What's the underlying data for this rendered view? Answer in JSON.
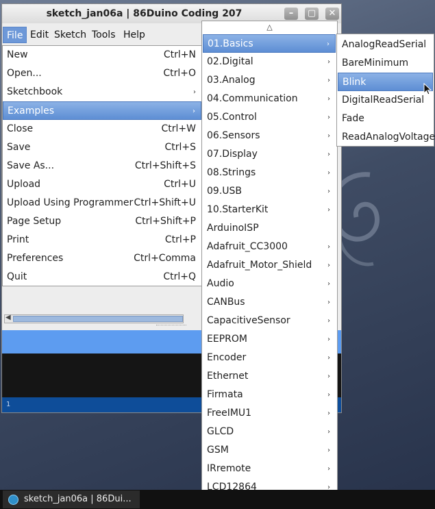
{
  "window": {
    "title": "sketch_jan06a | 86Duino Coding 207",
    "buttons": {
      "minimize": "–",
      "maximize": "▢",
      "close": "✕"
    }
  },
  "menubar": [
    "File",
    "Edit",
    "Sketch",
    "Tools",
    "Help"
  ],
  "file_menu": [
    {
      "label": "New",
      "shortcut": "Ctrl+N"
    },
    {
      "label": "Open...",
      "shortcut": "Ctrl+O"
    },
    {
      "label": "Sketchbook",
      "submenu": true
    },
    {
      "label": "Examples",
      "submenu": true,
      "selected": true
    },
    {
      "label": "Close",
      "shortcut": "Ctrl+W"
    },
    {
      "label": "Save",
      "shortcut": "Ctrl+S"
    },
    {
      "label": "Save As...",
      "shortcut": "Ctrl+Shift+S"
    },
    {
      "label": "Upload",
      "shortcut": "Ctrl+U"
    },
    {
      "label": "Upload Using Programmer",
      "shortcut": "Ctrl+Shift+U"
    },
    {
      "label": "Page Setup",
      "shortcut": "Ctrl+Shift+P"
    },
    {
      "label": "Print",
      "shortcut": "Ctrl+P"
    },
    {
      "label": "Preferences",
      "shortcut": "Ctrl+Comma"
    },
    {
      "label": "Quit",
      "shortcut": "Ctrl+Q"
    }
  ],
  "examples_menu": {
    "scroll_up": "△",
    "scroll_down": "▼",
    "items": [
      {
        "label": "01.Basics",
        "submenu": true,
        "selected": true
      },
      {
        "label": "02.Digital",
        "submenu": true
      },
      {
        "label": "03.Analog",
        "submenu": true
      },
      {
        "label": "04.Communication",
        "submenu": true
      },
      {
        "label": "05.Control",
        "submenu": true
      },
      {
        "label": "06.Sensors",
        "submenu": true
      },
      {
        "label": "07.Display",
        "submenu": true
      },
      {
        "label": "08.Strings",
        "submenu": true
      },
      {
        "label": "09.USB",
        "submenu": true
      },
      {
        "label": "10.StarterKit",
        "submenu": true
      },
      {
        "label": "ArduinoISP",
        "submenu": false
      },
      {
        "label": "Adafruit_CC3000",
        "submenu": true
      },
      {
        "label": "Adafruit_Motor_Shield",
        "submenu": true
      },
      {
        "label": "Audio",
        "submenu": true
      },
      {
        "label": "CANBus",
        "submenu": true
      },
      {
        "label": "CapacitiveSensor",
        "submenu": true
      },
      {
        "label": "EEPROM",
        "submenu": true
      },
      {
        "label": "Encoder",
        "submenu": true
      },
      {
        "label": "Ethernet",
        "submenu": true
      },
      {
        "label": "Firmata",
        "submenu": true
      },
      {
        "label": "FreeIMU1",
        "submenu": true
      },
      {
        "label": "GLCD",
        "submenu": true
      },
      {
        "label": "GSM",
        "submenu": true
      },
      {
        "label": "IRremote",
        "submenu": true
      },
      {
        "label": "LCD12864",
        "submenu": true
      }
    ]
  },
  "basics_menu": [
    {
      "label": "AnalogReadSerial"
    },
    {
      "label": "BareMinimum"
    },
    {
      "label": "Blink",
      "selected": true
    },
    {
      "label": "DigitalReadSerial"
    },
    {
      "label": "Fade"
    },
    {
      "label": "ReadAnalogVoltage"
    }
  ],
  "status": {
    "line": "1"
  },
  "taskbar": {
    "task_label": "sketch_jan06a | 86Dui..."
  },
  "colors": {
    "selection": "#5d8ed4",
    "console_bg": "#151515",
    "status_bg": "#0e4d99",
    "editor_band": "#5d9cf0"
  },
  "icons": {
    "submenu": "chevron-right-icon",
    "cursor": "mouse-pointer-icon"
  }
}
